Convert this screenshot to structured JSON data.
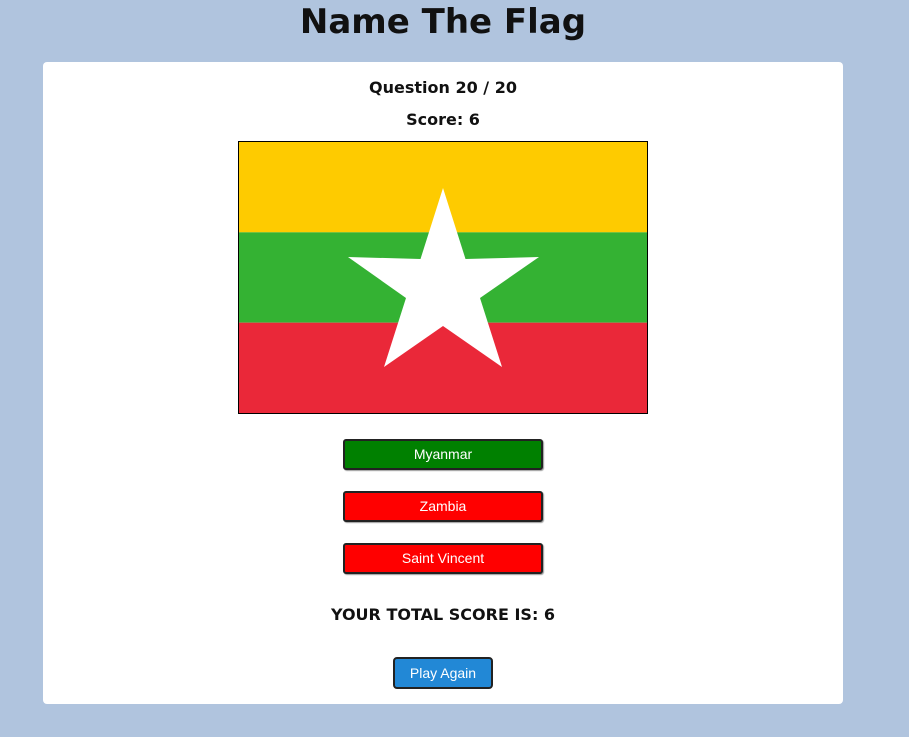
{
  "header": {
    "title": "Name The Flag"
  },
  "quiz": {
    "question_label": "Question 20 / 20",
    "score_label": "Score: 6",
    "flag": {
      "country": "Myanmar",
      "stripe_colors": [
        "#fecb00",
        "#34b233",
        "#ea2839"
      ],
      "star_color": "#ffffff"
    },
    "answers": [
      {
        "label": "Myanmar",
        "state": "correct",
        "color": "#008000"
      },
      {
        "label": "Zambia",
        "state": "wrong",
        "color": "#ff0000"
      },
      {
        "label": "Saint Vincent",
        "state": "wrong",
        "color": "#ff0000"
      }
    ],
    "total_score_label": "YOUR TOTAL SCORE IS: 6",
    "play_again_label": "Play Again"
  }
}
